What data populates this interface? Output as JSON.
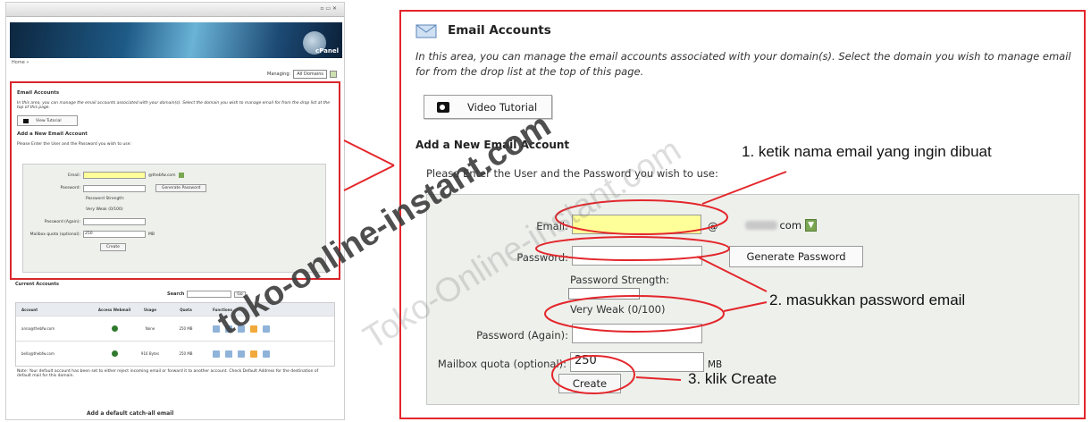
{
  "thumbnail": {
    "home_label": "Home »",
    "managing_label": "Managing:",
    "managing_value": "All Domains",
    "cpanel_text": "cPanel",
    "email_title": "Email Accounts",
    "email_desc": "In this area, you can manage the email accounts associated with your domain(s). Select the domain you wish to manage email for from the drop list at the top of this page.",
    "video_label": "View Tutorial",
    "add_title": "Add a New Email Account",
    "instr": "Please Enter the User and the Password you wish to use:",
    "email_label": "Email:",
    "domain": "@thebfw.com",
    "password_label": "Password:",
    "gen_btn": "Generate Password",
    "strength_label": "Password Strength:",
    "strength_val": "Very Weak (0/100)",
    "again_label": "Password (Again):",
    "quota_label": "Mailbox quota (optional):",
    "quota_val": "250",
    "mb": "MB",
    "create": "Create",
    "accounts_title": "Current Accounts",
    "search_label": "Search",
    "search_go": "Go",
    "cols": [
      "Account",
      "Access Webmail",
      "Usage",
      "Quota",
      "Functions"
    ],
    "rows": [
      {
        "account": "anna@thebfw.com",
        "usage": "None",
        "quota": "250 MB"
      },
      {
        "account": "bella@thebfw.com",
        "usage": "916 Bytes",
        "quota": "250 MB"
      }
    ],
    "note": "Note: Your default account has been set to either reject incoming email or forward it to another account. Check Default Address for the destination of default mail for this domain.",
    "footer": "Add a default catch-all email"
  },
  "panel": {
    "title": "Email Accounts",
    "desc": "In this area, you can manage the email accounts associated with your domain(s). Select the domain you wish to manage email for from the drop list at the top of this page.",
    "video_label": "Video Tutorial",
    "add_title": "Add a New Email Account",
    "instr": "Please Enter the User and the Password you wish to use:",
    "email_label": "Email:",
    "at": "@",
    "domain_suffix": "com",
    "password_label": "Password:",
    "gen_btn": "Generate Password",
    "strength_label": "Password Strength:",
    "strength_val": "Very Weak (0/100)",
    "again_label": "Password (Again):",
    "quota_label": "Mailbox quota (optional):",
    "quota_val": "250",
    "mb": "MB",
    "create": "Create"
  },
  "annotations": {
    "step1": "1. ketik nama email yang ingin dibuat",
    "step2": "2. masukkan password email",
    "step3": "3. klik Create"
  },
  "watermarks": {
    "dark": "toko-online-instant.com",
    "light": "Toko-Online-instant.com"
  },
  "colors": {
    "highlight_red": "#e3262b",
    "email_field_yellow": "#ffff99",
    "form_bg": "#eef0ec",
    "dropdown_green": "#7aa652"
  }
}
